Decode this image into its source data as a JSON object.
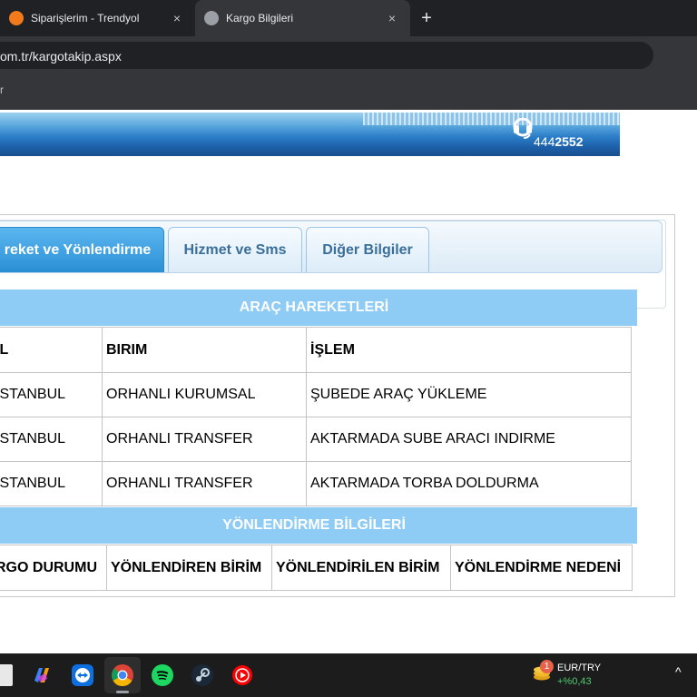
{
  "browser": {
    "tabs": [
      {
        "title": "Siparişlerim - Trendyol",
        "active": false,
        "favicon_color": "#f27a1a"
      },
      {
        "title": "Kargo Bilgileri",
        "active": true,
        "favicon_color": "#9aa0a6"
      }
    ],
    "close_glyph": "×",
    "newtab_glyph": "+",
    "url": "om.tr/kargotakip.aspx",
    "bookmark_mark": "r"
  },
  "banner": {
    "phone_prefix": "444",
    "phone_suffix": "2552"
  },
  "page_tabs": [
    {
      "label": "reket ve Yönlendirme",
      "active": true
    },
    {
      "label": "Hizmet ve Sms",
      "active": false
    },
    {
      "label": "Diğer Bilgiler",
      "active": false
    }
  ],
  "arac": {
    "heading": "ARAÇ HAREKETLERİ",
    "columns": [
      "İL",
      "BIRIM",
      "İŞLEM"
    ],
    "rows": [
      [
        "İSTANBUL",
        "ORHANLI KURUMSAL",
        "ŞUBEDE ARAÇ YÜKLEME"
      ],
      [
        "İSTANBUL",
        "ORHANLI TRANSFER",
        "AKTARMADA SUBE ARACI INDIRME"
      ],
      [
        "İSTANBUL",
        "ORHANLI TRANSFER",
        "AKTARMADA TORBA DOLDURMA"
      ]
    ]
  },
  "yonlendirme": {
    "heading": "YÖNLENDİRME BİLGİLERİ",
    "columns": [
      "RGO DURUMU",
      "YÖNLENDİREN BİRİM",
      "YÖNLENDİRİLEN BİRİM",
      "YÖNLENDİRME NEDENİ"
    ]
  },
  "taskbar": {
    "icons": [
      "file-explorer-icon",
      "copilot-icon",
      "teamviewer-icon",
      "chrome-icon",
      "spotify-icon",
      "steam-icon",
      "youtube-icon"
    ],
    "fx_badge": "1",
    "fx_pair": "EUR/TRY",
    "fx_change": "+%0,43",
    "tray_chevron": "^"
  },
  "colors": {
    "accent": "#2b8fd6",
    "table_header": "#8ecbf5",
    "positive": "#4ecb71"
  }
}
